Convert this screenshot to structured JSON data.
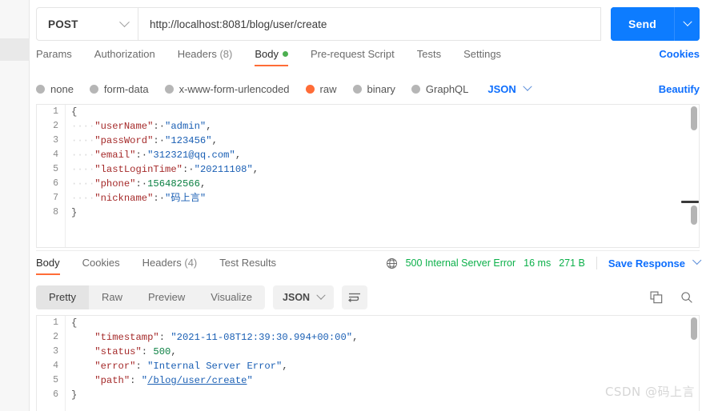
{
  "request": {
    "method": "POST",
    "url": "http://localhost:8081/blog/user/create",
    "send_label": "Send",
    "tabs": [
      {
        "label": "Params",
        "active": false
      },
      {
        "label": "Authorization",
        "active": false
      },
      {
        "label": "Headers (8)",
        "active": false
      },
      {
        "label": "Body",
        "active": true,
        "dot": true
      },
      {
        "label": "Pre-request Script",
        "active": false
      },
      {
        "label": "Tests",
        "active": false
      },
      {
        "label": "Settings",
        "active": false
      }
    ],
    "cookies_link": "Cookies",
    "body_types": [
      {
        "label": "none",
        "selected": false
      },
      {
        "label": "form-data",
        "selected": false
      },
      {
        "label": "x-www-form-urlencoded",
        "selected": false
      },
      {
        "label": "raw",
        "selected": true
      },
      {
        "label": "binary",
        "selected": false
      },
      {
        "label": "GraphQL",
        "selected": false
      }
    ],
    "format_selected": "JSON",
    "beautify_label": "Beautify",
    "body_lines": [
      {
        "n": "1",
        "segs": [
          {
            "t": "{",
            "c": "br"
          }
        ]
      },
      {
        "n": "2",
        "segs": [
          {
            "t": "····",
            "c": "indent-dots"
          },
          {
            "t": "\"userName\"",
            "c": "k"
          },
          {
            "t": ":·",
            "c": "p"
          },
          {
            "t": "\"admin\"",
            "c": "s"
          },
          {
            "t": ",",
            "c": "p"
          }
        ]
      },
      {
        "n": "3",
        "segs": [
          {
            "t": "····",
            "c": "indent-dots"
          },
          {
            "t": "\"passWord\"",
            "c": "k"
          },
          {
            "t": ":·",
            "c": "p"
          },
          {
            "t": "\"123456\"",
            "c": "s"
          },
          {
            "t": ",",
            "c": "p"
          }
        ]
      },
      {
        "n": "4",
        "segs": [
          {
            "t": "····",
            "c": "indent-dots"
          },
          {
            "t": "\"email\"",
            "c": "k"
          },
          {
            "t": ":·",
            "c": "p"
          },
          {
            "t": "\"312321@qq.com\"",
            "c": "s"
          },
          {
            "t": ",",
            "c": "p"
          }
        ]
      },
      {
        "n": "5",
        "segs": [
          {
            "t": "····",
            "c": "indent-dots"
          },
          {
            "t": "\"lastLoginTime\"",
            "c": "k"
          },
          {
            "t": ":·",
            "c": "p"
          },
          {
            "t": "\"20211108\"",
            "c": "s"
          },
          {
            "t": ",",
            "c": "p"
          }
        ]
      },
      {
        "n": "6",
        "segs": [
          {
            "t": "····",
            "c": "indent-dots"
          },
          {
            "t": "\"phone\"",
            "c": "k"
          },
          {
            "t": ":·",
            "c": "p"
          },
          {
            "t": "156482566",
            "c": "n"
          },
          {
            "t": ",",
            "c": "p"
          }
        ]
      },
      {
        "n": "7",
        "segs": [
          {
            "t": "····",
            "c": "indent-dots"
          },
          {
            "t": "\"nickname\"",
            "c": "k"
          },
          {
            "t": ":·",
            "c": "p"
          },
          {
            "t": "\"码上言\"",
            "c": "s"
          }
        ]
      },
      {
        "n": "8",
        "segs": [
          {
            "t": "}",
            "c": "br"
          }
        ]
      }
    ]
  },
  "response": {
    "tabs": [
      {
        "label": "Body",
        "active": true
      },
      {
        "label": "Cookies",
        "active": false
      },
      {
        "label": "Headers (4)",
        "active": false
      },
      {
        "label": "Test Results",
        "active": false
      }
    ],
    "status": "500 Internal Server Error",
    "time": "16 ms",
    "size": "271 B",
    "save_label": "Save Response",
    "view_modes": [
      {
        "label": "Pretty",
        "active": true
      },
      {
        "label": "Raw",
        "active": false
      },
      {
        "label": "Preview",
        "active": false
      },
      {
        "label": "Visualize",
        "active": false
      }
    ],
    "format_selected": "JSON",
    "body_lines": [
      {
        "n": "1",
        "segs": [
          {
            "t": "{",
            "c": "br"
          }
        ]
      },
      {
        "n": "2",
        "segs": [
          {
            "t": "    ",
            "c": "p"
          },
          {
            "t": "\"timestamp\"",
            "c": "k"
          },
          {
            "t": ": ",
            "c": "p"
          },
          {
            "t": "\"2021-11-08T12:39:30.994+00:00\"",
            "c": "s"
          },
          {
            "t": ",",
            "c": "p"
          }
        ]
      },
      {
        "n": "3",
        "segs": [
          {
            "t": "    ",
            "c": "p"
          },
          {
            "t": "\"status\"",
            "c": "k"
          },
          {
            "t": ": ",
            "c": "p"
          },
          {
            "t": "500",
            "c": "n"
          },
          {
            "t": ",",
            "c": "p"
          }
        ]
      },
      {
        "n": "4",
        "segs": [
          {
            "t": "    ",
            "c": "p"
          },
          {
            "t": "\"error\"",
            "c": "k"
          },
          {
            "t": ": ",
            "c": "p"
          },
          {
            "t": "\"Internal Server Error\"",
            "c": "s"
          },
          {
            "t": ",",
            "c": "p"
          }
        ]
      },
      {
        "n": "5",
        "segs": [
          {
            "t": "    ",
            "c": "p"
          },
          {
            "t": "\"path\"",
            "c": "k"
          },
          {
            "t": ": ",
            "c": "p"
          },
          {
            "t": "\"",
            "c": "s"
          },
          {
            "t": "/blog/user/create",
            "c": "lnk"
          },
          {
            "t": "\"",
            "c": "s"
          }
        ]
      },
      {
        "n": "6",
        "segs": [
          {
            "t": "}",
            "c": "br"
          }
        ]
      }
    ]
  },
  "watermark": "CSDN @码上言",
  "colors": {
    "accent_orange": "#ff6c37",
    "link_blue": "#0d6efd",
    "send_blue": "#0d7cff",
    "status_green": "#0cb04a",
    "json_key": "#a52a2a",
    "json_string": "#1a5fb4",
    "json_number": "#0b8043"
  }
}
